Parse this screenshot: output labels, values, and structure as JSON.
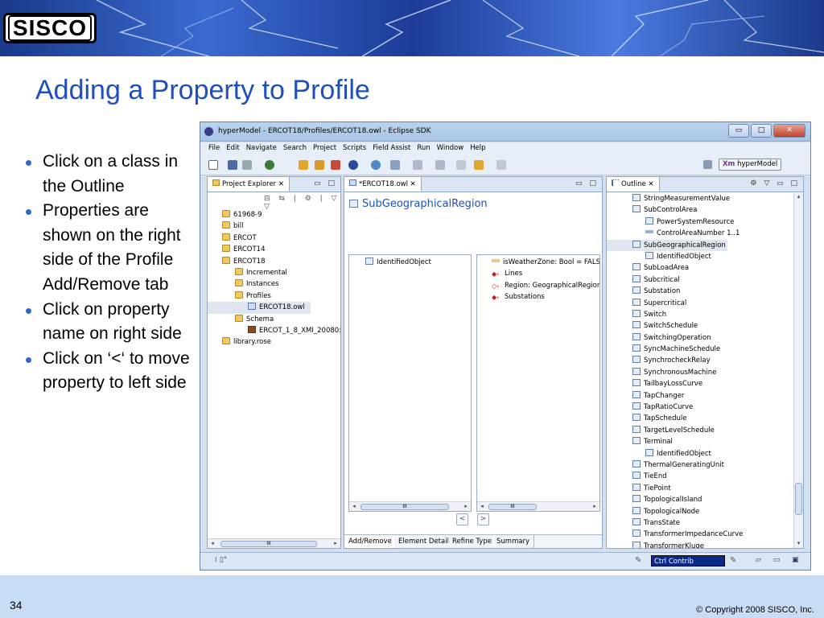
{
  "slide": {
    "title": "Adding a Property to Profile",
    "logo_text": "SISCO",
    "bullets": [
      "Click on a class in the Outline",
      "Properties are shown on the right side of the Profile Add/Remove tab",
      "Click on property name on right side",
      "Click on ‘<‘ to move property to left side"
    ],
    "slide_number": "34",
    "copyright": "© Copyright 2008 SISCO, Inc."
  },
  "window": {
    "title": "hyperModel - ERCOT18/Profiles/ERCOT18.owl - Eclipse SDK",
    "menu": [
      "File",
      "Edit",
      "Navigate",
      "Search",
      "Project",
      "Scripts",
      "Field Assist",
      "Run",
      "Window",
      "Help"
    ],
    "perspective": "hyperModel",
    "perspective_prefix": "Xm"
  },
  "project_explorer": {
    "tab_label": "Project Explorer",
    "items": [
      {
        "label": "61968-9",
        "icon": "project-icon",
        "depth": 0
      },
      {
        "label": "bill",
        "icon": "project-icon",
        "depth": 0
      },
      {
        "label": "ERCOT",
        "icon": "project-icon",
        "depth": 0
      },
      {
        "label": "ERCOT14",
        "icon": "project-icon",
        "depth": 0
      },
      {
        "label": "ERCOT18",
        "icon": "project-icon",
        "depth": 0
      },
      {
        "label": "Incremental",
        "icon": "folder-icon",
        "depth": 1
      },
      {
        "label": "Instances",
        "icon": "folder-icon",
        "depth": 1
      },
      {
        "label": "Profiles",
        "icon": "folder-icon",
        "depth": 1
      },
      {
        "label": "ERCOT18.owl",
        "icon": "owl-file-icon",
        "depth": 2
      },
      {
        "label": "Schema",
        "icon": "folder-icon",
        "depth": 1
      },
      {
        "label": "ERCOT_1_8_XMI_20080:",
        "icon": "xmi-file-icon",
        "depth": 2
      },
      {
        "label": "library.rose",
        "icon": "project-icon",
        "depth": 0
      }
    ],
    "scroll_thumb": "III"
  },
  "editor": {
    "tab_label": "*ERCOT18.owl",
    "class_name": "SubGeographicalRegion",
    "left_list": [
      "IdentifiedObject"
    ],
    "right_list": [
      {
        "label": "isWeatherZone: Bool = FALS",
        "icon": "attribute-icon"
      },
      {
        "label": "Lines",
        "icon": "association-icon"
      },
      {
        "label": "Region: GeographicalRegion",
        "icon": "association-hollow-icon"
      },
      {
        "label": "Substations",
        "icon": "association-icon"
      }
    ],
    "move_left": "<",
    "move_right": ">",
    "scroll_thumb": "III",
    "bottom_tabs": [
      "Add/Remove",
      "Element Detail",
      "Refine Type",
      "Summary"
    ]
  },
  "outline": {
    "tab_label": "Outline",
    "items": [
      {
        "label": "StringMeasurementValue",
        "depth": 0
      },
      {
        "label": "SubControlArea",
        "depth": 0
      },
      {
        "label": "PowerSystemResource",
        "depth": 1
      },
      {
        "label": "ControlAreaNumber 1..1",
        "depth": 1
      },
      {
        "label": "SubGeographicalRegion",
        "depth": 0
      },
      {
        "label": "IdentifiedObject",
        "depth": 1
      },
      {
        "label": "SubLoadArea",
        "depth": 0
      },
      {
        "label": "Subcritical",
        "depth": 0
      },
      {
        "label": "Substation",
        "depth": 0
      },
      {
        "label": "Supercritical",
        "depth": 0
      },
      {
        "label": "Switch",
        "depth": 0
      },
      {
        "label": "SwitchSchedule",
        "depth": 0
      },
      {
        "label": "SwitchingOperation",
        "depth": 0
      },
      {
        "label": "SyncMachineSchedule",
        "depth": 0
      },
      {
        "label": "SynchrocheckRelay",
        "depth": 0
      },
      {
        "label": "SynchronousMachine",
        "depth": 0
      },
      {
        "label": "TailbayLossCurve",
        "depth": 0
      },
      {
        "label": "TapChanger",
        "depth": 0
      },
      {
        "label": "TapRatioCurve",
        "depth": 0
      },
      {
        "label": "TapSchedule",
        "depth": 0
      },
      {
        "label": "TargetLevelSchedule",
        "depth": 0
      },
      {
        "label": "Terminal",
        "depth": 0
      },
      {
        "label": "IdentifiedObject",
        "depth": 1
      },
      {
        "label": "ThermalGeneratingUnit",
        "depth": 0
      },
      {
        "label": "TieEnd",
        "depth": 0
      },
      {
        "label": "TiePoint",
        "depth": 0
      },
      {
        "label": "TopologicalIsland",
        "depth": 0
      },
      {
        "label": "TopologicalNode",
        "depth": 0
      },
      {
        "label": "TransState",
        "depth": 0
      },
      {
        "label": "TransformerImpedanceCurve",
        "depth": 0
      },
      {
        "label": "TransformerKluge",
        "depth": 0
      }
    ]
  },
  "status": {
    "ctrl_contrib": "Ctrl Contrib (Bottom)"
  }
}
